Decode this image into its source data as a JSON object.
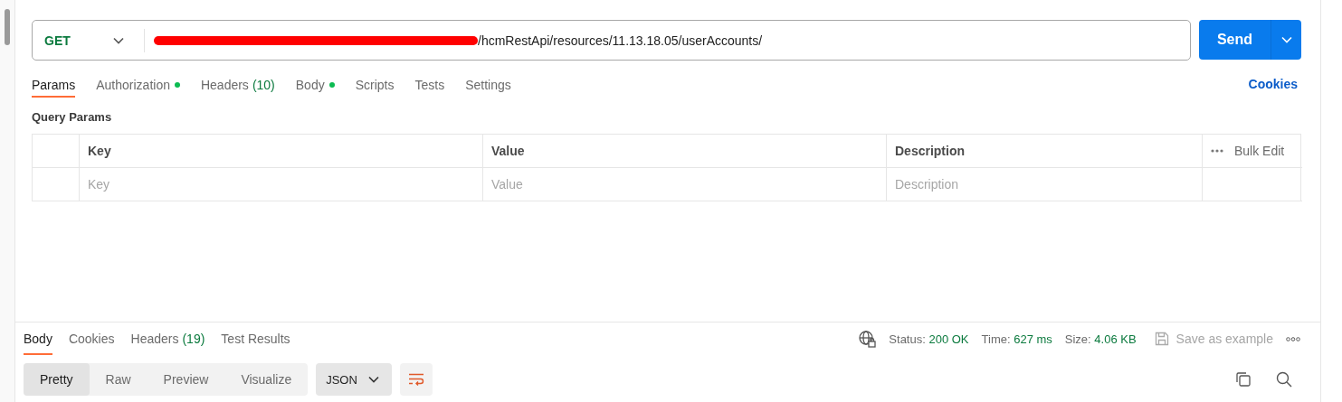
{
  "request": {
    "method": "GET",
    "url": "/hcmRestApi/resources/11.13.18.05/userAccounts/",
    "send": "Send"
  },
  "request_tabs": [
    {
      "label": "Params",
      "selected": true,
      "dot": false
    },
    {
      "label": "Authorization",
      "selected": false,
      "dot": true
    },
    {
      "label": "Headers",
      "count": "(10)",
      "selected": false,
      "dot": false
    },
    {
      "label": "Body",
      "selected": false,
      "dot": true
    },
    {
      "label": "Scripts",
      "selected": false,
      "dot": false
    },
    {
      "label": "Tests",
      "selected": false,
      "dot": false
    },
    {
      "label": "Settings",
      "selected": false,
      "dot": false
    }
  ],
  "cookies_link": "Cookies",
  "query_params": {
    "title": "Query Params",
    "columns": [
      "Key",
      "Value",
      "Description"
    ],
    "bulk_edit": "Bulk Edit",
    "placeholders": [
      "Key",
      "Value",
      "Description"
    ]
  },
  "response_tabs": [
    {
      "label": "Body",
      "selected": true
    },
    {
      "label": "Cookies",
      "selected": false
    },
    {
      "label": "Headers",
      "count": "(19)",
      "selected": false
    },
    {
      "label": "Test Results",
      "selected": false
    }
  ],
  "response_status": [
    {
      "label": "Status:",
      "value": "200 OK"
    },
    {
      "label": "Time:",
      "value": "627 ms"
    },
    {
      "label": "Size:",
      "value": "4.06 KB"
    }
  ],
  "save_example": "Save as example",
  "view_modes": [
    {
      "label": "Pretty",
      "selected": true
    },
    {
      "label": "Raw",
      "selected": false
    },
    {
      "label": "Preview",
      "selected": false
    },
    {
      "label": "Visualize",
      "selected": false
    }
  ],
  "format": "JSON"
}
